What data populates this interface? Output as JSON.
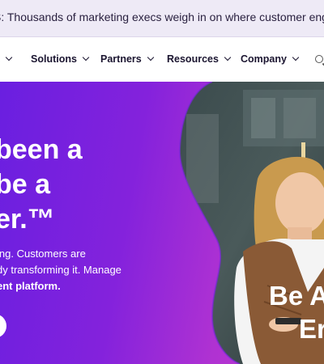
{
  "announcement": {
    "text": "S: Thousands of marketing execs weigh in on where customer engag"
  },
  "nav": {
    "items": [
      {
        "label": "t"
      },
      {
        "label": "Solutions"
      },
      {
        "label": "Partners"
      },
      {
        "label": "Resources"
      },
      {
        "label": "Company"
      }
    ]
  },
  "hero": {
    "headline": [
      "been a",
      "be a",
      "er.™"
    ],
    "subcopy": {
      "line1": "ing. Customers are",
      "line2": "dy transforming it. Manage",
      "line3": "ent platform."
    },
    "image_overlay": {
      "line1": "Be A",
      "line2": "Er"
    }
  },
  "colors": {
    "brand_purple": "#6a1fe0",
    "hero_pink": "#c23ecb",
    "nav_text": "#1b1530",
    "banner_bg": "#eeeaf6"
  },
  "icons": {
    "search": "search-icon",
    "chevron": "chevron-down-icon"
  }
}
